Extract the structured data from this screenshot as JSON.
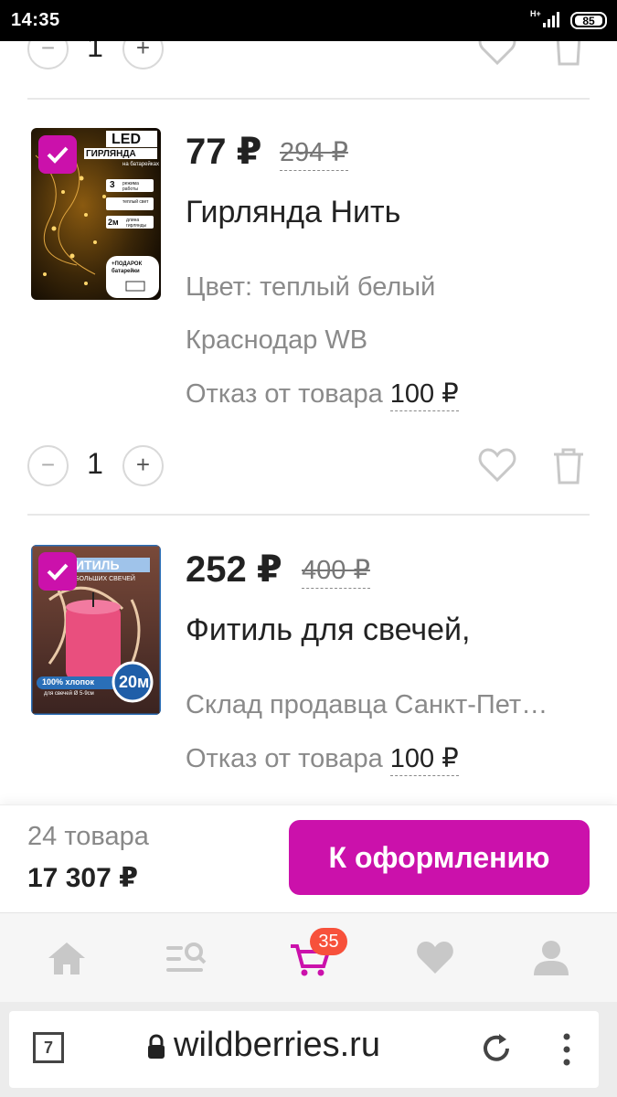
{
  "status_bar": {
    "time": "14:35",
    "network": "H+",
    "battery": "85"
  },
  "cart": {
    "top_partial_item": {
      "quantity": "1"
    },
    "items": [
      {
        "price": "77 ₽",
        "old_price": "294 ₽",
        "name": "Гирлянда Нить",
        "details": [
          "Цвет: теплый белый",
          "Краснодар WB"
        ],
        "refusal_label": "Отказ от товара",
        "refusal_amount": "100 ₽",
        "quantity": "1",
        "thumbnail": {
          "badge_text": "LED",
          "title": "ГИРЛЯНДА",
          "subtitle": "на батарейках",
          "features": [
            {
              "num": "3",
              "text": "режима работы"
            },
            {
              "num": "",
              "text": "теплый свет"
            },
            {
              "num": "2м",
              "text": "длина гирлянды"
            }
          ],
          "gift": "+ПОДАРОК батарейки"
        }
      },
      {
        "price": "252 ₽",
        "old_price": "400 ₽",
        "name": "Фитиль для свечей,",
        "details": [
          "Склад продавца Санкт-Пет…"
        ],
        "refusal_label": "Отказ от товара",
        "refusal_amount": "100 ₽",
        "thumbnail": {
          "title": "ФИТИЛЬ",
          "subtitle": "БОЛЬШИХ СВЕЧЕЙ",
          "material": "100% хлопок",
          "note": "для свечей Ø 5-9см",
          "length": "20м"
        }
      }
    ],
    "summary": {
      "count": "24 товара",
      "total": "17 307 ₽"
    },
    "checkout_label": "К оформлению"
  },
  "bottom_nav": {
    "items": [
      "home-icon",
      "catalog-search-icon",
      "cart-icon",
      "favorites-icon",
      "profile-icon"
    ],
    "cart_badge": "35",
    "accent": "#cb11ab",
    "inactive": "#c8c8c8"
  },
  "browser": {
    "tabs_count": "7",
    "url": "wildberries.ru"
  },
  "colors": {
    "brand": "#cb11ab",
    "badge": "#f7513b"
  }
}
